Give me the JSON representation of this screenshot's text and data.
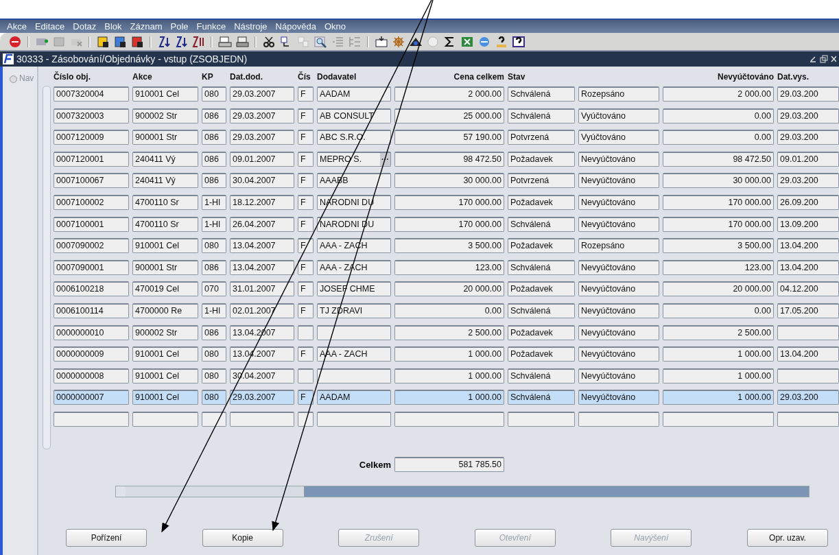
{
  "menu": [
    "Akce",
    "Editace",
    "Dotaz",
    "Blok",
    "Záznam",
    "Pole",
    "Funkce",
    "Nástroje",
    "Nápověda",
    "Okno"
  ],
  "window": {
    "title": "30333 - Zásobování/Objednávky - vstup (ZSOBJEDN)"
  },
  "nav": {
    "label": "Nav",
    "selected": false
  },
  "table": {
    "columns": [
      "Číslo obj.",
      "Akce",
      "KP",
      "Dat.dod.",
      "Čís",
      "Dodavatel",
      "Cena celkem",
      "Stav",
      "",
      "Nevyúčtováno",
      "Dat.vys."
    ],
    "rows": [
      {
        "cislo": "0007320004",
        "akce": "910001 Cel",
        "kp": "080",
        "dat_dod": "29.03.2007",
        "cis": "F",
        "dodavatel": "AADAM",
        "cena": "2 000.00",
        "stav": "Schválená",
        "column_9": "Rozepsáno",
        "nevyuctovano": "2 000.00",
        "dat_vys": "29.03.200",
        "selected": false
      },
      {
        "cislo": "0007320003",
        "akce": "900002 Str",
        "kp": "086",
        "dat_dod": "29.03.2007",
        "cis": "F",
        "dodavatel": "AB CONSULT",
        "cena": "25 000.00",
        "stav": "Schválená",
        "column_9": "Vyúčtováno",
        "nevyuctovano": "0.00",
        "dat_vys": "29.03.200",
        "selected": false
      },
      {
        "cislo": "0007120009",
        "akce": "900001 Str",
        "kp": "086",
        "dat_dod": "29.03.2007",
        "cis": "F",
        "dodavatel": "ABC S.R.O.",
        "cena": "57 190.00",
        "stav": "Potvrzená",
        "column_9": "Vyúčtováno",
        "nevyuctovano": "0.00",
        "dat_vys": "29.03.200",
        "selected": false
      },
      {
        "cislo": "0007120001",
        "akce": "240411 Vý",
        "kp": "086",
        "dat_dod": "09.01.2007",
        "cis": "F",
        "dodavatel": "MEPRO S.",
        "lov": "···",
        "cena": "98 472.50",
        "stav": "Požadavek",
        "column_9": "Nevyúčtováno",
        "nevyuctovano": "98 472.50",
        "dat_vys": "09.01.200",
        "selected": false
      },
      {
        "cislo": "0007100067",
        "akce": "240411 Vý",
        "kp": "086",
        "dat_dod": "30.04.2007",
        "cis": "F",
        "dodavatel": "AAABB",
        "cena": "30 000.00",
        "stav": "Potvrzená",
        "column_9": "Nevyúčtováno",
        "nevyuctovano": "30 000.00",
        "dat_vys": "29.03.200",
        "selected": false
      },
      {
        "cislo": "0007100002",
        "akce": "4700110 Sr",
        "kp": "1-Hl",
        "dat_dod": "18.12.2007",
        "cis": "F",
        "dodavatel": "NARODNI DU",
        "cena": "170 000.00",
        "stav": "Požadavek",
        "column_9": "Nevyúčtováno",
        "nevyuctovano": "170 000.00",
        "dat_vys": "26.09.200",
        "selected": false
      },
      {
        "cislo": "0007100001",
        "akce": "4700110 Sr",
        "kp": "1-Hl",
        "dat_dod": "26.04.2007",
        "cis": "F",
        "dodavatel": "NARODNI DU",
        "cena": "170 000.00",
        "stav": "Schválená",
        "column_9": "Nevyúčtováno",
        "nevyuctovano": "170 000.00",
        "dat_vys": "13.09.200",
        "selected": false
      },
      {
        "cislo": "0007090002",
        "akce": "910001 Cel",
        "kp": "080",
        "dat_dod": "13.04.2007",
        "cis": "F",
        "dodavatel": "AAA - ZACH",
        "cena": "3 500.00",
        "stav": "Požadavek",
        "column_9": "Rozepsáno",
        "nevyuctovano": "3 500.00",
        "dat_vys": "13.04.200",
        "selected": false
      },
      {
        "cislo": "0007090001",
        "akce": "900001 Str",
        "kp": "086",
        "dat_dod": "13.04.2007",
        "cis": "F",
        "dodavatel": "AAA - ZACH",
        "cena": "123.00",
        "stav": "Schválená",
        "column_9": "Nevyúčtováno",
        "nevyuctovano": "123.00",
        "dat_vys": "13.04.200",
        "selected": false
      },
      {
        "cislo": "0006100218",
        "akce": "470019 Cel",
        "kp": "070",
        "dat_dod": "31.01.2007",
        "cis": "F",
        "dodavatel": "JOSEF CHME",
        "cena": "20 000.00",
        "stav": "Požadavek",
        "column_9": "Nevyúčtováno",
        "nevyuctovano": "20 000.00",
        "dat_vys": "04.12.200",
        "selected": false
      },
      {
        "cislo": "0006100114",
        "akce": "4700000 Re",
        "kp": "1-Hl",
        "dat_dod": "02.01.2007",
        "cis": "F",
        "dodavatel": "TJ ZDRAVI",
        "cena": "0.00",
        "stav": "Schválená",
        "column_9": "Nevyúčtováno",
        "nevyuctovano": "0.00",
        "dat_vys": "17.05.200",
        "selected": false
      },
      {
        "cislo": "0000000010",
        "akce": "900002 Str",
        "kp": "086",
        "dat_dod": "13.04.2007",
        "cena": "2 500.00",
        "stav": "Požadavek",
        "column_9": "Nevyúčtováno",
        "nevyuctovano": "2 500.00",
        "selected": false
      },
      {
        "cislo": "0000000009",
        "akce": "910001 Cel",
        "kp": "080",
        "dat_dod": "13.04.2007",
        "cis": "F",
        "dodavatel": "AAA - ZACH",
        "cena": "1 000.00",
        "stav": "Požadavek",
        "column_9": "Nevyúčtováno",
        "nevyuctovano": "1 000.00",
        "dat_vys": "13.04.200",
        "selected": false
      },
      {
        "cislo": "0000000008",
        "akce": "910001 Cel",
        "kp": "080",
        "dat_dod": "30.04.2007",
        "cena": "1 000.00",
        "stav": "Schválená",
        "column_9": "Nevyúčtováno",
        "nevyuctovano": "1 000.00",
        "selected": false
      },
      {
        "cislo": "0000000007",
        "akce": "910001 Cel",
        "kp": "080",
        "dat_dod": "29.03.2007",
        "cis": "F",
        "dodavatel": "AADAM",
        "cena": "1 000.00",
        "stav": "Schválená",
        "column_9": "Nevyúčtováno",
        "nevyuctovano": "1 000.00",
        "dat_vys": "29.03.200",
        "selected": true
      },
      {
        "selected": false
      }
    ]
  },
  "total": {
    "label": "Celkem",
    "value": "581 785.50"
  },
  "buttons": [
    {
      "label": "Pořízení",
      "disabled": false
    },
    {
      "label": "Kopie",
      "disabled": false
    },
    {
      "label": "Zrušení",
      "disabled": true
    },
    {
      "label": "Otevření",
      "disabled": true
    },
    {
      "label": "Navýšení",
      "disabled": true
    },
    {
      "label": "Opr. uzav.",
      "disabled": false
    }
  ]
}
